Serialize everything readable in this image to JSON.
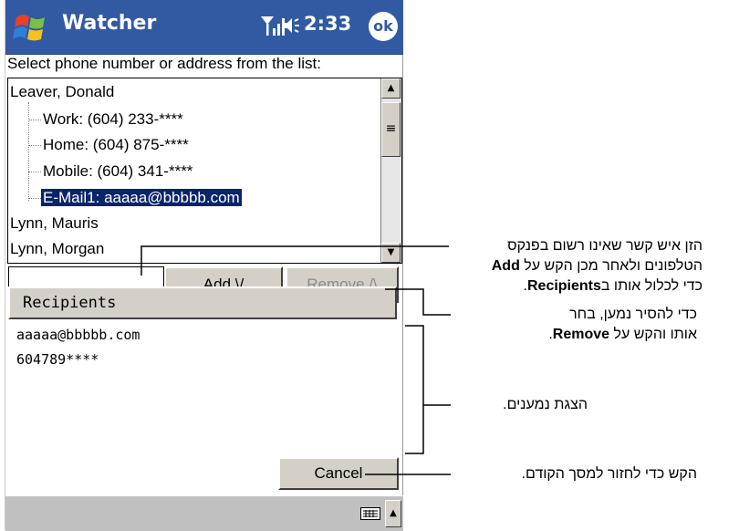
{
  "app": {
    "title": "Watcher",
    "time": "2:33",
    "ok_label": "ok"
  },
  "prompt": "Select phone number or address from the list:",
  "contacts": {
    "contact1": "Leaver, Donald",
    "work": "Work: (604) 233-****",
    "home": "Home: (604) 875-****",
    "mobile": "Mobile: (604) 341-****",
    "email": "E-Mail1: aaaaa@bbbbb.com",
    "contact2": "Lynn, Mauris",
    "contact3": "Lynn, Morgan"
  },
  "entry": {
    "value": ""
  },
  "buttons": {
    "add": "Add \\/",
    "remove": "Remove /\\",
    "cancel": "Cancel"
  },
  "recipients": {
    "header": "Recipients",
    "items": [
      "aaaaa@bbbbb.com",
      "604789****"
    ]
  },
  "callouts": {
    "add_line1": "הזן איש קשר שאינו רשום בפנקס",
    "add_line2_pre": "הטלפונים ולאחר מכן הקש על ",
    "add_line2_bold": "Add",
    "add_line3_pre": "כדי לכלול אותו ב",
    "add_line3_bold": "Recipients",
    "add_line3_post": ".",
    "remove_line1": "כדי להסיר נמען, בחר",
    "remove_line2_pre": "אותו והקש על ",
    "remove_line2_bold": "Remove",
    "remove_line2_post": ".",
    "recipients_view": "הצגת נמענים.",
    "cancel_desc": "הקש כדי לחזור למסך הקודם."
  },
  "colors": {
    "titlebar": "#315aa3",
    "selection": "#0a246a",
    "button_face": "#d4d0c8",
    "bottombar": "#c0c0c0"
  },
  "icons": {
    "logo": "windows-flag-icon",
    "signal": "signal-icon",
    "speaker": "speaker-icon",
    "keyboard": "keyboard-icon",
    "sip_arrow": "chevron-up-icon"
  }
}
